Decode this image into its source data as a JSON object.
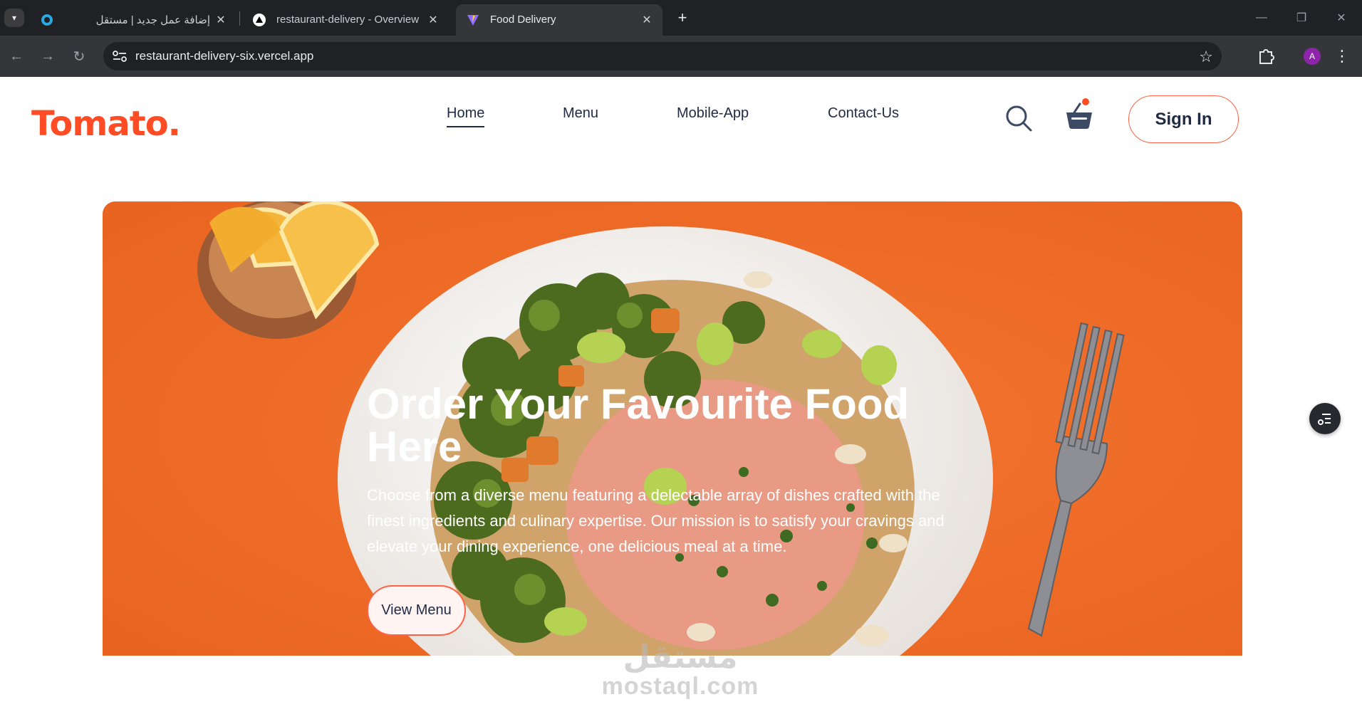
{
  "browser": {
    "tabs": [
      {
        "label": "إضافة عمل جديد | مستقل",
        "icon": "mostaql-icon"
      },
      {
        "label": "restaurant-delivery - Overview -",
        "icon": "vercel-icon"
      },
      {
        "label": "Food Delivery",
        "icon": "vite-icon",
        "active": true
      }
    ],
    "url": "restaurant-delivery-six.vercel.app",
    "profile_initial": "A"
  },
  "site": {
    "logo": "Tomato.",
    "nav": [
      "Home",
      "Menu",
      "Mobile-App",
      "Contact-Us"
    ],
    "active_nav": "Home",
    "signin_label": "Sign In",
    "accent_color": "#ff4c24"
  },
  "hero": {
    "title": "Order Your Favourite Food Here",
    "text": "Choose from a diverse menu featuring a delectable array of dishes crafted with the finest ingredients and culinary expertise. Our mission is to satisfy your cravings and elevate your dining experience, one delicious meal at a time.",
    "button_label": "View Menu"
  },
  "watermark": {
    "arabic": "مستقل",
    "latin": "mostaql.com"
  }
}
